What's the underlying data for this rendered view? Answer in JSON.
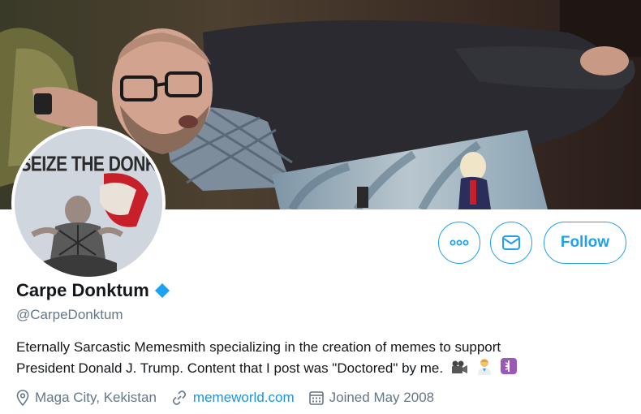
{
  "profile": {
    "display_name": "Carpe Donktum",
    "handle": "@CarpeDonktum",
    "verified": true,
    "avatar_caption": "SEIZE THE DONK",
    "bio_line_1": "Eternally Sarcastic Memesmith specializing in the creation of memes to support",
    "bio_line_2": "President Donald J. Trump. Content that I post was \"Doctored\" by me.",
    "bio_emojis": [
      "movie-camera",
      "health-worker",
      "medical-symbol"
    ],
    "location": "Maga City, Kekistan",
    "website": "memeworld.com",
    "joined": "Joined May 2008"
  },
  "actions": {
    "more_icon": "more-dots-icon",
    "message_icon": "envelope-icon",
    "follow_label": "Follow"
  },
  "colors": {
    "accent": "#1da1f2",
    "link": "#1b95e0",
    "muted": "#657786",
    "text": "#14171a",
    "verified": "#1da1f2"
  }
}
